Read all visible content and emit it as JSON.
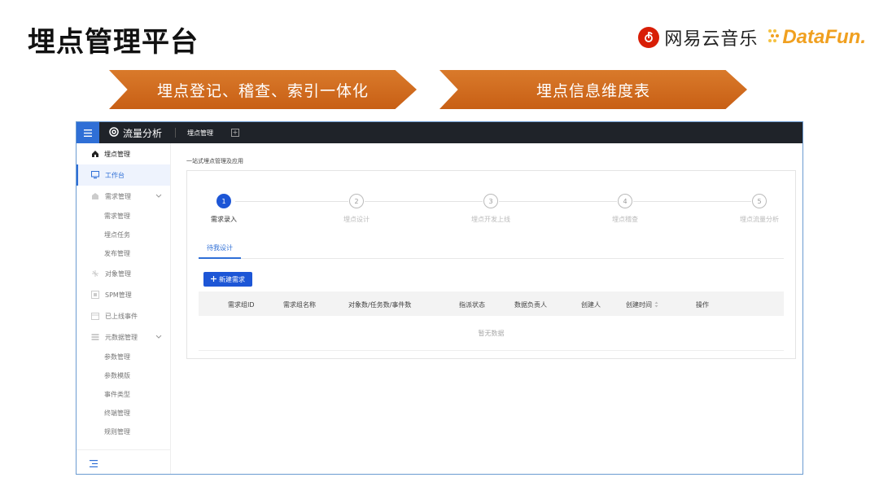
{
  "slide": {
    "title": "埋点管理平台",
    "logo_netease_text": "网易云音乐",
    "logo_datafun_text": "DataFun."
  },
  "banners": [
    "埋点登记、稽查、索引一体化",
    "埋点信息维度表"
  ],
  "app": {
    "brand_name": "流量分析",
    "top_tab": "埋点管理",
    "sidebar": {
      "header": "埋点管理",
      "workbench": "工作台",
      "groups": [
        {
          "label": "需求管理",
          "icon": "grid-icon",
          "children": [
            "需求管理",
            "埋点任务",
            "发布管理"
          ]
        },
        {
          "label": "对象管理",
          "icon": "object-icon",
          "children": []
        },
        {
          "label": "SPM管理",
          "icon": "spm-icon",
          "children": []
        },
        {
          "label": "已上线事件",
          "icon": "event-icon",
          "children": []
        },
        {
          "label": "元数据管理",
          "icon": "database-icon",
          "children": [
            "参数管理",
            "参数模版",
            "事件类型",
            "终端管理",
            "规则管理"
          ]
        }
      ]
    },
    "breadcrumb": "一站式埋点管理及应用",
    "steps": [
      {
        "num": "1",
        "label": "需求录入",
        "active": true
      },
      {
        "num": "2",
        "label": "埋点设计",
        "active": false
      },
      {
        "num": "3",
        "label": "埋点开发上线",
        "active": false
      },
      {
        "num": "4",
        "label": "埋点稽查",
        "active": false
      },
      {
        "num": "5",
        "label": "埋点流量分析",
        "active": false
      }
    ],
    "tab_active": "待我设计",
    "new_button": "新建需求",
    "table_columns": [
      "需求组ID",
      "需求组名称",
      "对象数/任务数/事件数",
      "指派状态",
      "数据负责人",
      "创建人",
      "创建时间",
      "操作"
    ],
    "empty_text": "暂无数据"
  },
  "colors": {
    "accent_blue": "#1d56d6",
    "banner_orange": "#c85f15",
    "topbar_dark": "#1f2329"
  }
}
